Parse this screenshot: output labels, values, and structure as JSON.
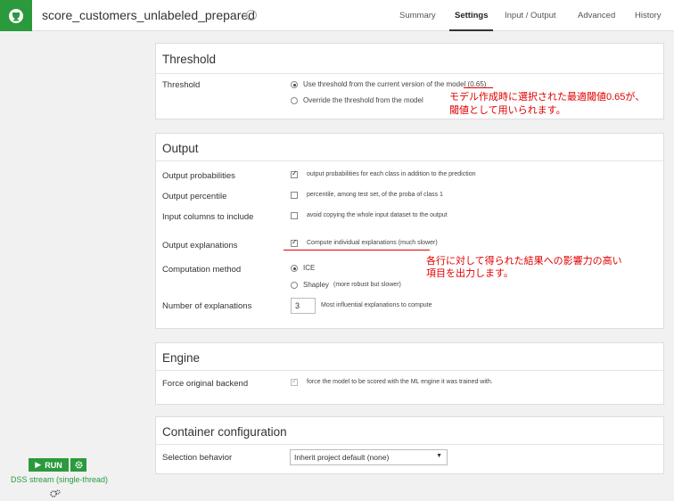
{
  "header": {
    "title": "score_customers_unlabeled_prepared",
    "tabs": [
      {
        "label": "Summary",
        "active": false
      },
      {
        "label": "Settings",
        "active": true
      },
      {
        "label": "Input / Output",
        "active": false
      },
      {
        "label": "Advanced",
        "active": false
      },
      {
        "label": "History",
        "active": false
      }
    ]
  },
  "sidebar": {
    "run_label": "RUN",
    "engine_label": "DSS stream (single-thread)"
  },
  "threshold": {
    "heading": "Threshold",
    "label": "Threshold",
    "option_use": "Use threshold from the current version of the model (0.65)",
    "option_override": "Override the threshold from the model",
    "selected": "use"
  },
  "output": {
    "heading": "Output",
    "probabilities": {
      "label": "Output probabilities",
      "desc": "output probabilities for each class in addition to the prediction",
      "checked": true
    },
    "percentile": {
      "label": "Output percentile",
      "desc": "percentile, among test set, of the proba of class 1",
      "checked": false
    },
    "input_columns": {
      "label": "Input columns to include",
      "desc": "avoid copying the whole input dataset to the output",
      "checked": false
    },
    "explanations": {
      "label": "Output explanations",
      "desc": "Compute individual explanations (much slower)",
      "checked": true
    },
    "computation": {
      "label": "Computation method",
      "ice": "ICE",
      "shapley": "Shapley",
      "shapley_note": "(more robust but slower)",
      "selected": "ICE"
    },
    "num_explanations": {
      "label": "Number of explanations",
      "value": "3",
      "desc": "Most influential explanations to compute"
    }
  },
  "engine": {
    "heading": "Engine",
    "force_backend": {
      "label": "Force original backend",
      "desc": "force the model to be scored with the ML engine it was trained with.",
      "checked": true
    }
  },
  "container": {
    "heading": "Container configuration",
    "selection_label": "Selection behavior",
    "selection_value": "Inherit project default (none)"
  },
  "annotations": {
    "threshold_note_line1": "モデル作成時に選択された最適閾値0.65が、",
    "threshold_note_line2": "閾値として用いられます。",
    "explanation_note_line1": "各行に対して得られた結果への影響力の高い",
    "explanation_note_line2": "項目を出力します。",
    "color": "#e10000"
  },
  "colors": {
    "brand": "#2a9a3c"
  }
}
